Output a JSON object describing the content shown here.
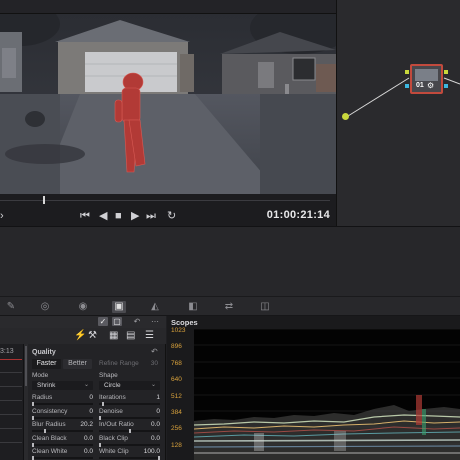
{
  "viewer": {
    "timecode": "01:00:21:14",
    "transport": {
      "first_frame": "⏮",
      "prev_frame": "◀",
      "stop": "■",
      "play": "▶",
      "last_frame": "⏭",
      "loop": "↻"
    },
    "playhead_fraction": 0.13
  },
  "node_graph": {
    "node_label": "01",
    "node_status_glyph": "⚙"
  },
  "toolbar": {
    "tools": [
      {
        "icon": "eyedropper-icon",
        "glyph": "✎"
      },
      {
        "icon": "window-icon",
        "glyph": "◎"
      },
      {
        "icon": "tracker-icon",
        "glyph": "◉"
      },
      {
        "icon": "qualifier-icon",
        "glyph": "▣"
      },
      {
        "icon": "blur-icon",
        "glyph": "◭"
      },
      {
        "icon": "key-icon",
        "glyph": "◧"
      },
      {
        "icon": "sizing-icon",
        "glyph": "⇄"
      },
      {
        "icon": "3d-icon",
        "glyph": "◫"
      }
    ]
  },
  "qualifier": {
    "timecode": "3:13",
    "tabs": [
      "✓",
      "▢",
      "↶",
      "⋯"
    ],
    "icon_row": [
      "⚡",
      "⚒",
      "▦",
      "▤",
      "☰"
    ],
    "quality_label": "Quality",
    "quality_faster": "Faster",
    "quality_better": "Better",
    "refine_range_label": "Refine Range",
    "refine_range_value": "30",
    "mode_label": "Mode",
    "mode_value": "Shrink",
    "shape_label": "Shape",
    "shape_value": "Circle",
    "params_left": [
      {
        "label": "Radius",
        "value": "0",
        "level": 0.0
      },
      {
        "label": "Consistency",
        "value": "0",
        "level": 0.0
      },
      {
        "label": "Blur Radius",
        "value": "20.2",
        "level": 0.2
      },
      {
        "label": "Clean Black",
        "value": "0.0",
        "level": 0.0
      },
      {
        "label": "Clean White",
        "value": "0.0",
        "level": 0.0
      }
    ],
    "params_right": [
      {
        "label": "Iterations",
        "value": "1",
        "level": 0.05
      },
      {
        "label": "Denoise",
        "value": "0",
        "level": 0.0
      },
      {
        "label": "In/Out Ratio",
        "value": "0.0",
        "level": 0.5
      },
      {
        "label": "Black Clip",
        "value": "0.0",
        "level": 0.0
      },
      {
        "label": "White Clip",
        "value": "100.0",
        "level": 1.0
      }
    ]
  },
  "scopes": {
    "title": "Scopes",
    "scale": [
      "1023",
      "896",
      "768",
      "640",
      "512",
      "384",
      "256",
      "128"
    ],
    "accent_color": "#d9a23c"
  }
}
